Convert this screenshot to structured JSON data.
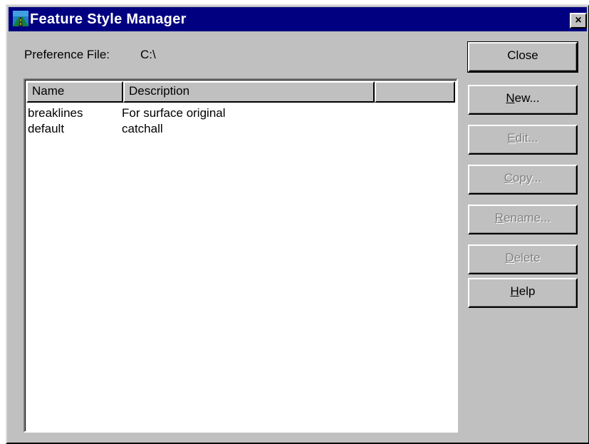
{
  "window": {
    "title": "Feature Style Manager",
    "close_glyph": "×",
    "icon": "app-road-icon"
  },
  "preference": {
    "label": "Preference File:",
    "value": "C:\\"
  },
  "list": {
    "columns": [
      "Name",
      "Description",
      ""
    ],
    "rows": [
      {
        "name": "breaklines",
        "description": "For surface original"
      },
      {
        "name": "default",
        "description": "catchall"
      }
    ]
  },
  "buttons": {
    "close": {
      "label": "Close",
      "enabled": true
    },
    "new": {
      "mnemonic": "N",
      "rest": "ew...",
      "enabled": true
    },
    "edit": {
      "mnemonic": "E",
      "rest": "dit...",
      "enabled": false
    },
    "copy": {
      "mnemonic": "C",
      "rest": "opy...",
      "enabled": false
    },
    "rename": {
      "mnemonic": "R",
      "rest": "ename...",
      "enabled": false
    },
    "delete": {
      "mnemonic": "D",
      "rest": "elete",
      "enabled": false
    },
    "help": {
      "mnemonic": "H",
      "rest": "elp",
      "enabled": true
    }
  },
  "colors": {
    "titlebar": "#000080",
    "face": "#c0c0c0",
    "disabled_text": "#808080"
  }
}
